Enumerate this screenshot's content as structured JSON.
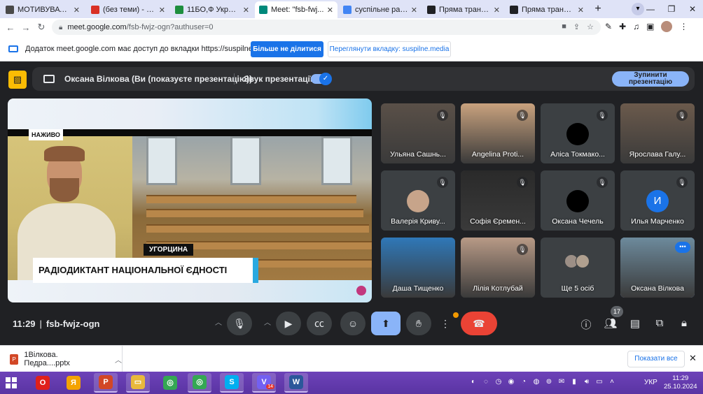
{
  "browser": {
    "tabs": [
      {
        "title": "МОТИВУВАТИ — ...",
        "color": "#4a4a4a",
        "active": false
      },
      {
        "title": "(без теми) - oksa...",
        "color": "#d93025",
        "active": false
      },
      {
        "title": "11БО,Ф Українськ...",
        "color": "#1e8e3e",
        "active": false
      },
      {
        "title": "Meet: \"fsb-fwj...",
        "color": "#00897b",
        "active": true
      },
      {
        "title": "суспільне радіод...",
        "color": "#4285f4",
        "active": false
      },
      {
        "title": "Пряма трансляці...",
        "color": "#202124",
        "active": false
      },
      {
        "title": "Пряма трансл...",
        "color": "#202124",
        "active": false
      }
    ],
    "new_tab": "+",
    "url_host": "meet.google.com",
    "url_path": "/fsb-fwjz-ogn?authuser=0"
  },
  "sharebar": {
    "message": "Додаток meet.google.com має доступ до вкладки https://suspilne.media",
    "stop_sharing": "Більше не ділитися",
    "view_tab": "Переглянути вкладку: suspilne.media"
  },
  "present": {
    "presenter": "Оксана Вілкова (Ви (показуєте презентацію))",
    "sound_label": "Звук презентації",
    "sound_on": true,
    "stop_presenting": "Зупинити презентацію"
  },
  "stage": {
    "live_badge": "НАЖИВО",
    "caption_name": "УГОРЦИНА",
    "caption_title": "РАДІОДИКТАНТ НАЦІОНАЛЬНОЇ ЄДНОСТІ"
  },
  "participants": [
    {
      "name": "Ульяна Сашнь...",
      "muted": true,
      "type": "photo",
      "tone": "#5a5048"
    },
    {
      "name": "Angelina Proti...",
      "muted": true,
      "type": "photo",
      "tone": "#c9a27e"
    },
    {
      "name": "Аліса Токмако...",
      "muted": true,
      "type": "dark",
      "initial": ""
    },
    {
      "name": "Ярослава Галу...",
      "muted": true,
      "type": "photo",
      "tone": "#6b5a4c"
    },
    {
      "name": "Валерія Криву...",
      "muted": true,
      "type": "avatar-photo",
      "tone": "#c7a48a"
    },
    {
      "name": "Софія Єремен...",
      "muted": true,
      "type": "photo",
      "tone": "#2a2a2a"
    },
    {
      "name": "Оксана Чечель",
      "muted": true,
      "type": "dark",
      "initial": ""
    },
    {
      "name": "Илья Марченко",
      "muted": true,
      "type": "initial",
      "initial": "И"
    },
    {
      "name": "Даша Тищенко",
      "muted": false,
      "type": "photo",
      "tone": "#2f78b8"
    },
    {
      "name": "Лілія Котлубай",
      "muted": true,
      "type": "photo",
      "tone": "#b89a86"
    },
    {
      "name": "Ще 5 осіб",
      "muted": false,
      "type": "more",
      "initial": ""
    },
    {
      "name": "Оксана Вілкова",
      "muted": false,
      "type": "self",
      "tone": "#6d8a9c"
    }
  ],
  "controls": {
    "time": "11:29",
    "meeting_code": "fsb-fwjz-ogn",
    "people_count": "17"
  },
  "downloads": {
    "file": "1Вілкова. Педра....pptx",
    "show_all": "Показати все"
  },
  "taskbar": {
    "language": "УКР",
    "time": "11:29",
    "date": "25.10.2024",
    "apps": [
      {
        "icon": "opera-icon",
        "glyph": "O",
        "color": "#e0201b",
        "open": false,
        "badge": ""
      },
      {
        "icon": "yandex-icon",
        "glyph": "Я",
        "color": "#f4a300",
        "open": false,
        "badge": ""
      },
      {
        "icon": "powerpoint-icon",
        "glyph": "P",
        "color": "#d24726",
        "open": true,
        "badge": ""
      },
      {
        "icon": "file-explorer-icon",
        "glyph": "▭",
        "color": "#e9b93b",
        "open": true,
        "badge": ""
      },
      {
        "icon": "chrome-icon",
        "glyph": "◎",
        "color": "#34a853",
        "open": false,
        "badge": ""
      },
      {
        "icon": "chrome-icon-2",
        "glyph": "◎",
        "color": "#34a853",
        "open": true,
        "badge": ""
      },
      {
        "icon": "skype-icon",
        "glyph": "S",
        "color": "#00aff0",
        "open": true,
        "badge": ""
      },
      {
        "icon": "viber-icon",
        "glyph": "V",
        "color": "#7360f2",
        "open": true,
        "badge": "14"
      },
      {
        "icon": "word-icon",
        "glyph": "W",
        "color": "#2b579a",
        "open": true,
        "badge": ""
      }
    ]
  },
  "colors": {
    "meet_bg": "#202124",
    "accent": "#8ab4f8",
    "end_call": "#ea4335",
    "taskbar": "#5a34a3"
  }
}
